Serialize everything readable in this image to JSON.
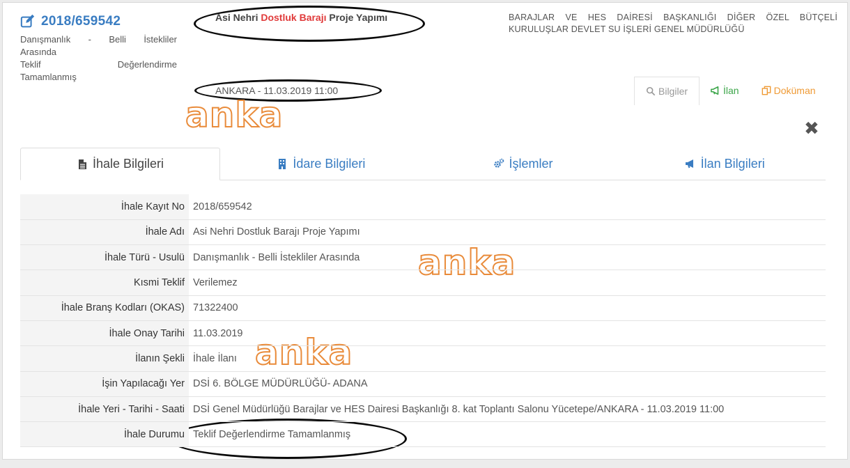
{
  "header": {
    "reg_no": "2018/659542",
    "type_line1": "Danışmanlık - Belli İstekliler",
    "type_line2": "Arasında",
    "status_line1": "Teklif Değerlendirme",
    "status_line2": "Tamamlanmış",
    "name_part1": "Asi Nehri ",
    "name_highlight": "Dostluk Barajı",
    "name_part2": " Proje Yapımı",
    "location_date": "ANKARA - 11.03.2019 11:00",
    "organization": "BARAJLAR VE HES DAİRESİ BAŞKANLIĞI DİĞER ÖZEL BÜTÇELİ KURULUŞLAR DEVLET SU İŞLERİ GENEL MÜDÜRLÜĞÜ",
    "highlight_color": "#e03a3a"
  },
  "mini_tabs": {
    "bilgiler": "Bilgiler",
    "ilan": "İlan",
    "dokuman": "Doküman"
  },
  "close_symbol": "✖",
  "watermarks": [
    "anka",
    "anka",
    "anka"
  ],
  "tabs": [
    {
      "label": "İhale Bilgileri",
      "icon": "file-icon"
    },
    {
      "label": "İdare Bilgileri",
      "icon": "building-icon"
    },
    {
      "label": "İşlemler",
      "icon": "cogs-icon"
    },
    {
      "label": "İlan Bilgileri",
      "icon": "bullhorn-icon"
    }
  ],
  "rows": [
    {
      "key": "İhale Kayıt No",
      "value": "2018/659542"
    },
    {
      "key": "İhale Adı",
      "value": "Asi Nehri Dostluk Barajı Proje Yapımı"
    },
    {
      "key": "İhale Türü - Usulü",
      "value": "Danışmanlık - Belli İstekliler Arasında"
    },
    {
      "key": "Kısmi Teklif",
      "value": "Verilemez"
    },
    {
      "key": "İhale Branş Kodları (OKAS)",
      "value": "71322400"
    },
    {
      "key": "İhale Onay Tarihi",
      "value": "11.03.2019"
    },
    {
      "key": "İlanın Şekli",
      "value": "İhale İlanı"
    },
    {
      "key": "İşin Yapılacağı Yer",
      "value": "DSİ 6. BÖLGE MÜDÜRLÜĞÜ- ADANA"
    },
    {
      "key": "İhale Yeri - Tarihi - Saati",
      "value": "DSİ Genel Müdürlüğü Barajlar ve HES Dairesi Başkanlığı 8. kat Toplantı Salonu Yücetepe/ANKARA - 11.03.2019 11:00"
    },
    {
      "key": "İhale Durumu",
      "value": "Teklif Değerlendirme Tamamlanmış"
    }
  ],
  "colors": {
    "accent": "#3a7dc2",
    "ilan_green": "#3ca64a",
    "dokuman_orange": "#ef9a35",
    "watermark_orange": "#e98b3a"
  }
}
